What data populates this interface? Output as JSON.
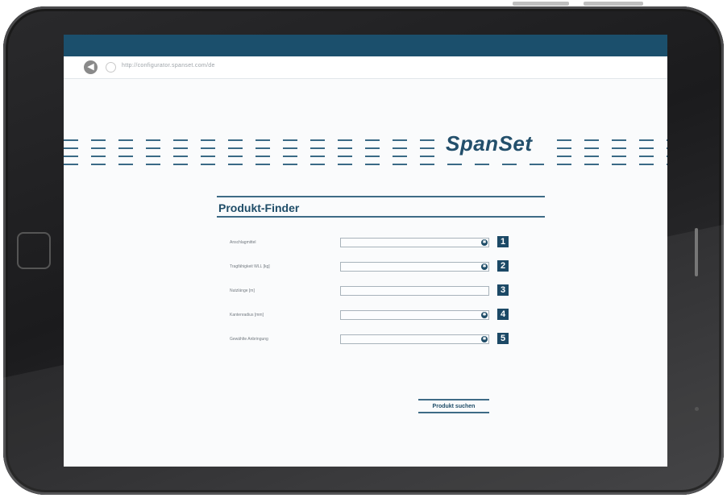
{
  "browser": {
    "url": "http://configurator.spanset.com/de"
  },
  "brand": {
    "logo_text": "SpanSet",
    "color": "#234f6b",
    "bar_color": "#1b4f6c"
  },
  "finder": {
    "title": "Produkt-Finder",
    "fields": [
      {
        "label": "Anschlagmittel",
        "number": "1",
        "has_gear": true,
        "value": ""
      },
      {
        "label": "Tragfähigkeit WLL [kg]",
        "number": "2",
        "has_gear": true,
        "value": ""
      },
      {
        "label": "Nutzlänge [m]",
        "number": "3",
        "has_gear": false,
        "value": ""
      },
      {
        "label": "Kantenradius [mm]",
        "number": "4",
        "has_gear": true,
        "value": ""
      },
      {
        "label": "Gewählte Anbringung",
        "number": "5",
        "has_gear": true,
        "value": ""
      }
    ],
    "search_button": "Produkt suchen"
  },
  "icons": {
    "back": "back-arrow-icon",
    "history": "clock-icon",
    "gear": "gear-icon"
  }
}
